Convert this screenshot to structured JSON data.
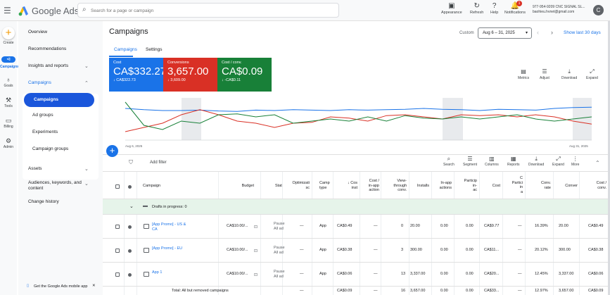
{
  "header": {
    "brand": "Google Ads",
    "search_placeholder": "Search for a page or campaign",
    "tools": [
      {
        "icon": "appearance-icon",
        "label": "Appearance"
      },
      {
        "icon": "refresh-icon",
        "label": "Refresh"
      },
      {
        "icon": "help-icon",
        "label": "Help"
      },
      {
        "icon": "notifications-icon",
        "label": "Notifications",
        "badge": "1"
      }
    ],
    "account_line1": "977-954-9209 CNC SIGNAL SL...",
    "account_line2": "baohieu.hvnet@gmail.com",
    "avatar_letter": "C"
  },
  "rail": {
    "create": "Create",
    "items": [
      {
        "label": "Campaigns"
      },
      {
        "label": "Goals"
      },
      {
        "label": "Tools"
      },
      {
        "label": "Billing"
      },
      {
        "label": "Admin"
      }
    ]
  },
  "nav": {
    "overview": "Overview",
    "recommendations": "Recommendations",
    "insights": "Insights and reports",
    "campaigns": "Campaigns",
    "sub": [
      "Campaigns",
      "Ad groups",
      "Experiments",
      "Campaign groups"
    ],
    "assets": "Assets",
    "audiences": "Audiences, keywords, and content",
    "change_history": "Change history",
    "mobile_app": "Get the Google Ads mobile app"
  },
  "main": {
    "title": "Campaigns",
    "custom": "Custom",
    "date_range": "Aug 6 – 31, 2025",
    "show_last": "Show last 30 days",
    "tabs": [
      "Campaigns",
      "Settings"
    ]
  },
  "kpis": [
    {
      "label": "Cost",
      "value": "CA$332.27",
      "prev": "↓ CA$322.73",
      "color": "#1a73e8"
    },
    {
      "label": "Conversions",
      "value": "3,657.00",
      "prev": "↓ 3,609.00",
      "color": "#d93025"
    },
    {
      "label": "Cost / conv.",
      "value": "CA$0.09",
      "prev": "↓ -CA$0.11",
      "color": "#188038"
    }
  ],
  "chart_tools": [
    "Metrics",
    "Adjust",
    "Download",
    "Expand"
  ],
  "chart_data": {
    "type": "line",
    "x_start": "Aug 6, 2025",
    "x_end": "Aug 31, 2025",
    "series": [
      {
        "color": "#1a73e8",
        "values": [
          0.25,
          0.28,
          0.3,
          0.3,
          0.29,
          0.31,
          0.32,
          0.29,
          0.3,
          0.28,
          0.29,
          0.3,
          0.28,
          0.29,
          0.28,
          0.27,
          0.25,
          0.27,
          0.28,
          0.3,
          0.27,
          0.28,
          0.29,
          0.25,
          0.23,
          0.22
        ]
      },
      {
        "color": "#d93025",
        "values": [
          0.8,
          0.7,
          0.6,
          0.4,
          0.28,
          0.4,
          0.55,
          0.6,
          0.7,
          0.6,
          0.58,
          0.45,
          0.48,
          0.55,
          0.42,
          0.4,
          0.45,
          0.5,
          0.4,
          0.42,
          0.4,
          0.45,
          0.4,
          0.45,
          0.55,
          0.62
        ]
      },
      {
        "color": "#188038",
        "values": [
          0.1,
          0.65,
          0.75,
          0.55,
          0.6,
          0.4,
          0.38,
          0.45,
          0.4,
          0.6,
          0.55,
          0.5,
          0.55,
          0.45,
          0.55,
          0.42,
          0.48,
          0.5,
          0.45,
          0.5,
          0.45,
          0.4,
          0.5,
          0.55,
          0.5,
          0.45
        ]
      }
    ]
  },
  "filter": {
    "add_filter": "Add filter",
    "tools": [
      "Search",
      "Segment",
      "Columns",
      "Reports",
      "Download",
      "Expand",
      "More"
    ]
  },
  "table": {
    "headers": {
      "campaign": "Campaign",
      "budget": "Budget",
      "status": "Stat",
      "optim": "Optimizati\nsc",
      "type": "Camp\ntype",
      "cost_install": "↓ Cos\ninst",
      "cost_inapp": "Cost /\nin-app\naction",
      "view_through": "View-\nthrough\nconv.",
      "installs": "Installs",
      "inapp": "In-app\nactions",
      "particip_ac": "Particip\nin-\nac",
      "cost": "Cost",
      "particip": "C\nPartici\nin\na",
      "conv_rate": "Conv.\nrate",
      "conversions": "Conver",
      "cost_conv": "Cost /\nconv."
    },
    "drafts": "Drafts in progress: 0",
    "rows": [
      {
        "name": "[App Promo] - US & CA",
        "budget": "CA$10.00/...",
        "status": "Pause\nAll ad",
        "opt": "—",
        "type": "App",
        "cost_install": "CA$0.49",
        "cost_inapp": "—",
        "vt": "0",
        "installs": "20.00",
        "inapp": "0.00",
        "pa": "0.00",
        "cost": "CA$9.77",
        "pc": "—",
        "rate": "16.39%",
        "conv": "20.00",
        "cpc": "CA$0.49"
      },
      {
        "name": "[App Promo] - EU",
        "budget": "CA$10.00/...",
        "status": "Pause\nAll ad",
        "opt": "—",
        "type": "App",
        "cost_install": "CA$0.38",
        "cost_inapp": "—",
        "vt": "3",
        "installs": "300.00",
        "inapp": "0.00",
        "pa": "0.00",
        "cost": "CA$11...",
        "pc": "—",
        "rate": "20.12%",
        "conv": "300.00",
        "cpc": "CA$0.38"
      },
      {
        "name": "App 1",
        "budget": "CA$10.00/...",
        "status": "Pause\nAll ad",
        "opt": "—",
        "type": "App",
        "cost_install": "CA$0.06",
        "cost_inapp": "—",
        "vt": "13",
        "installs": "3,337.00",
        "inapp": "0.00",
        "pa": "0.00",
        "cost": "CA$20...",
        "pc": "—",
        "rate": "12.45%",
        "conv": "3,337.00",
        "cpc": "CA$0.06"
      }
    ],
    "total": {
      "label": "Total: All but removed campaigns",
      "opt": "—",
      "cost_install": "CA$0.09",
      "cost_inapp": "—",
      "vt": "16",
      "installs": "3,657.00",
      "inapp": "0.00",
      "pa": "0.00",
      "cost": "CA$33...",
      "pc": "—",
      "rate": "12.97%",
      "conv": "3,657.00",
      "cpc": "CA$0.09"
    }
  }
}
